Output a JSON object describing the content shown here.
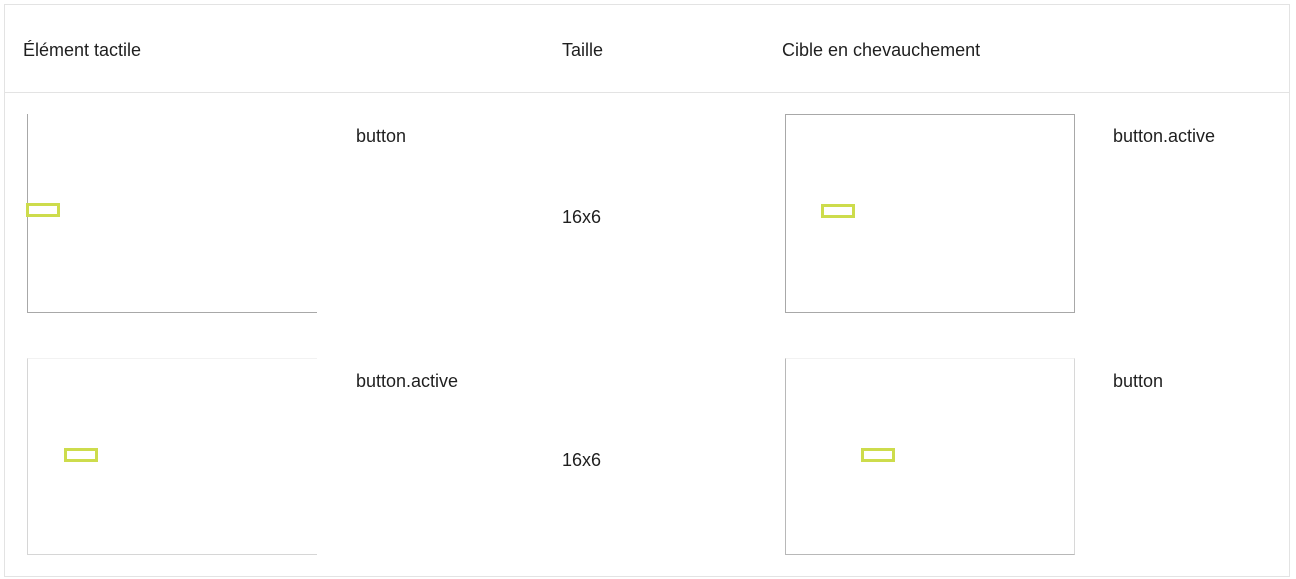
{
  "table": {
    "headers": {
      "element": "Élément tactile",
      "size": "Taille",
      "overlap": "Cible en chevauchement"
    },
    "rows": [
      {
        "element_label": "button",
        "size": "16x6",
        "overlap_label": "button.active"
      },
      {
        "element_label": "button.active",
        "size": "16x6",
        "overlap_label": "button"
      }
    ]
  },
  "colors": {
    "target_outline": "#cddc4c",
    "border": "#e3e3e3"
  }
}
